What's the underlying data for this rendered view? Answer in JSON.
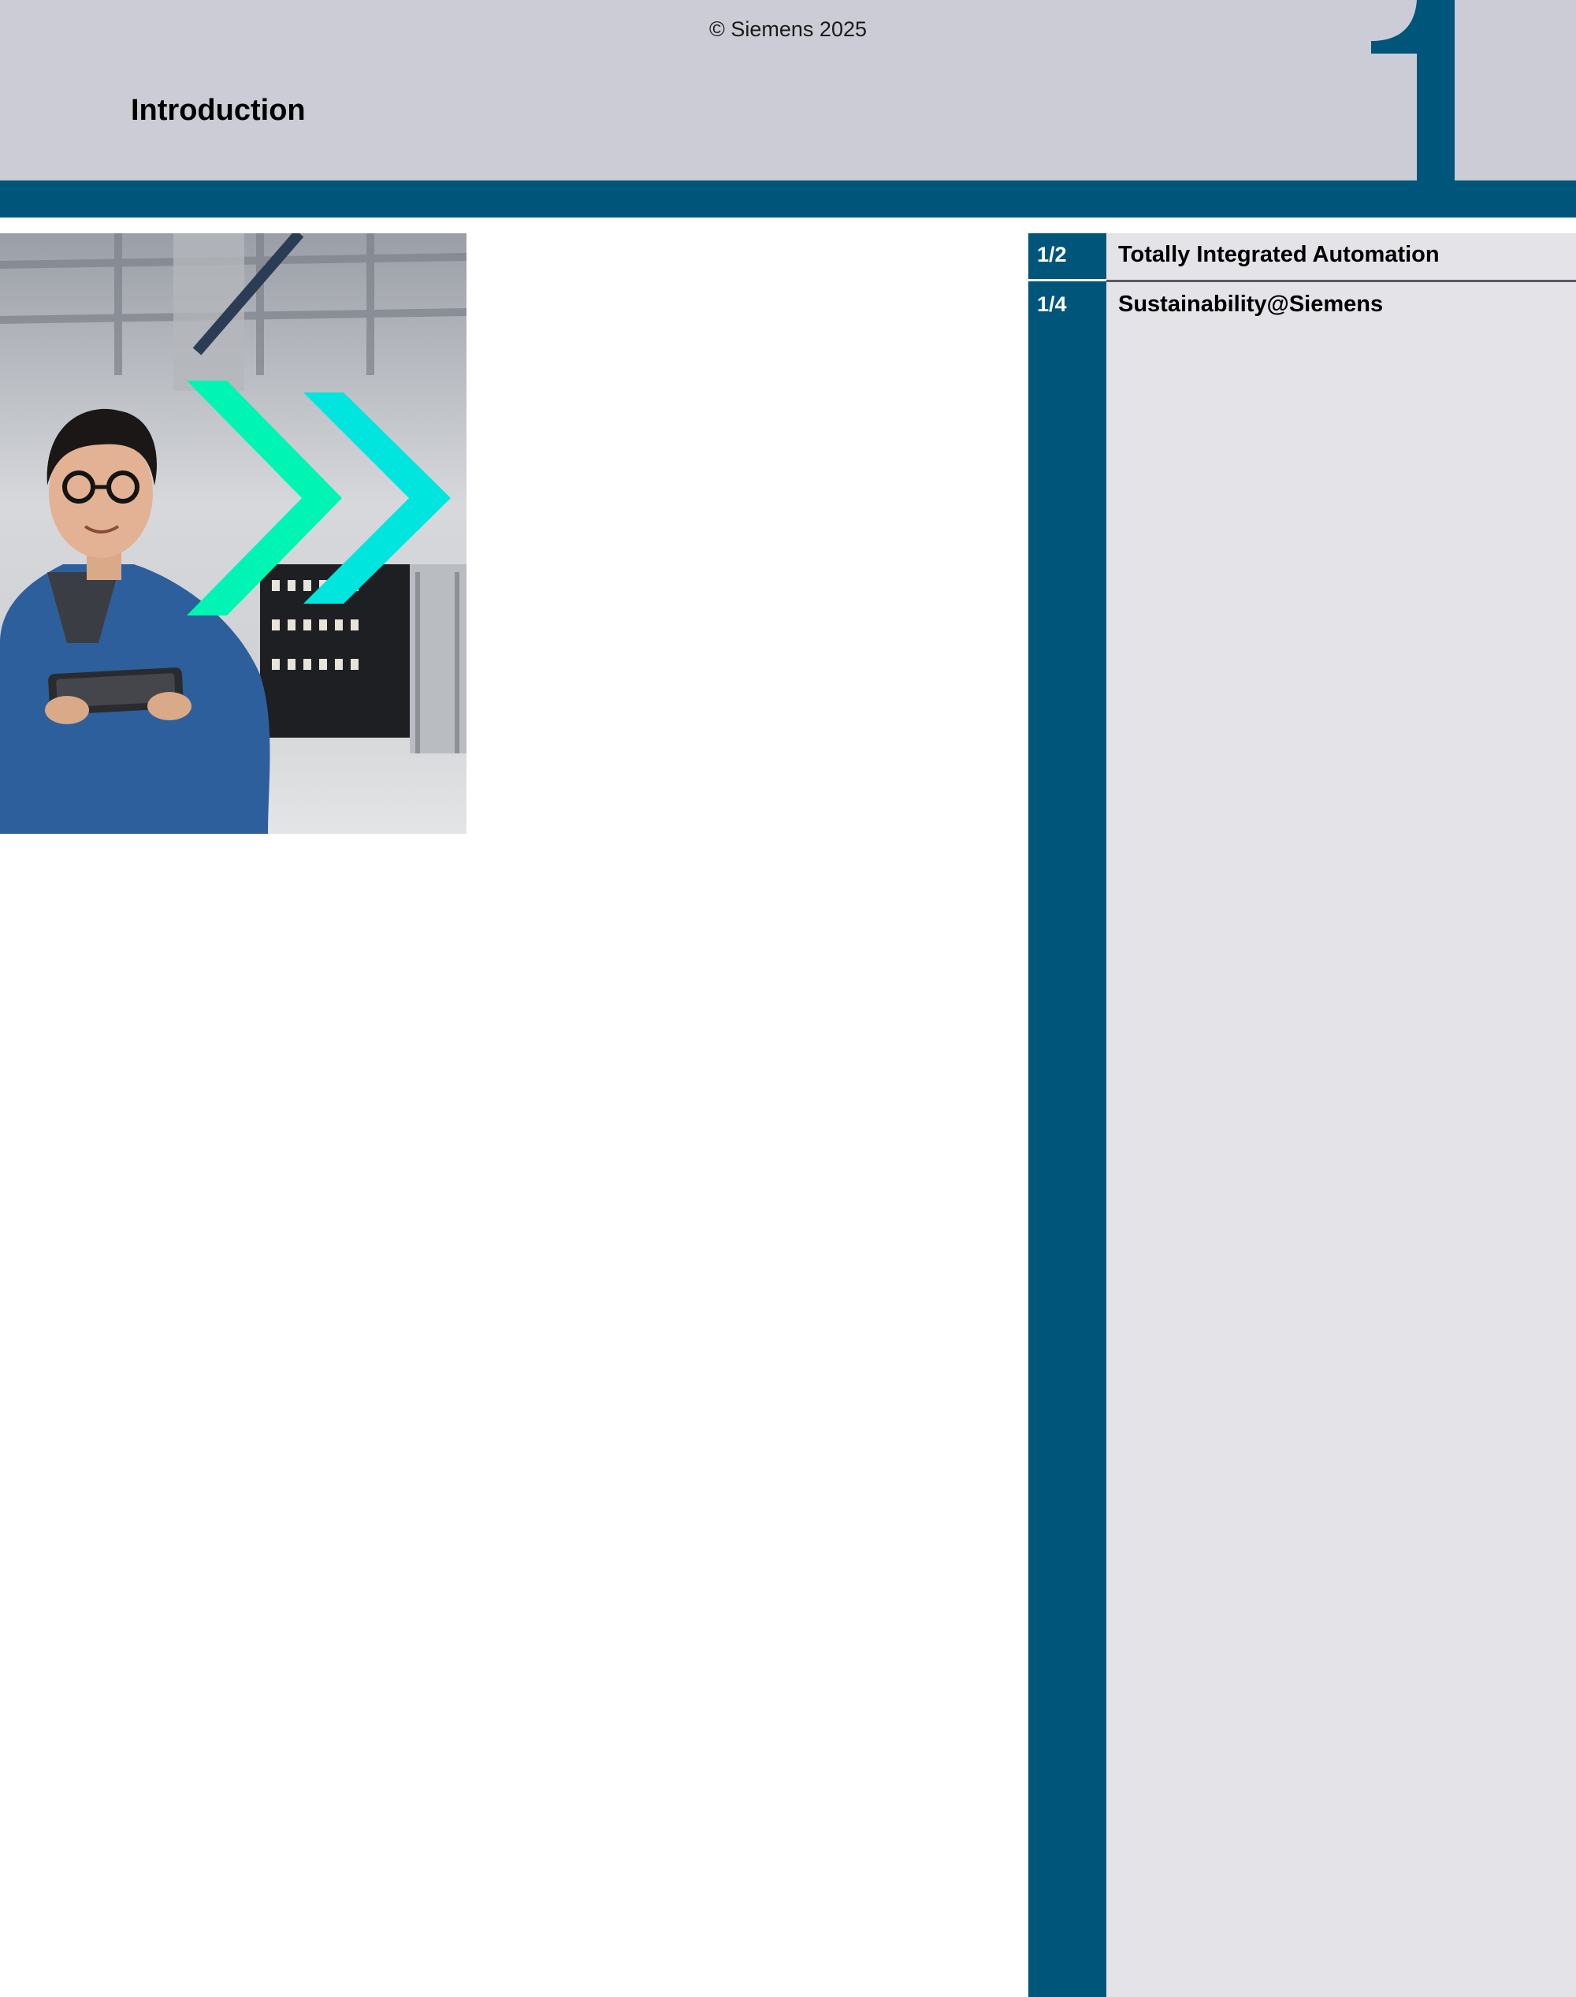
{
  "header": {
    "copyright": "© Siemens 2025",
    "title": "Introduction",
    "chapter_number": "1"
  },
  "colors": {
    "brand_petrol": "#00557a",
    "header_grey": "#cbccd5",
    "toc_panel": "#e3e3e8",
    "arrow_green": "#00f5b4",
    "arrow_cyan": "#00e5de"
  },
  "photo": {
    "icon": "siemens-double-chevron-icon"
  },
  "toc": {
    "items": [
      {
        "number": "1/2",
        "label": "Totally Integrated Automation"
      },
      {
        "number": "1/4",
        "label": "Sustainability@Siemens"
      }
    ]
  }
}
